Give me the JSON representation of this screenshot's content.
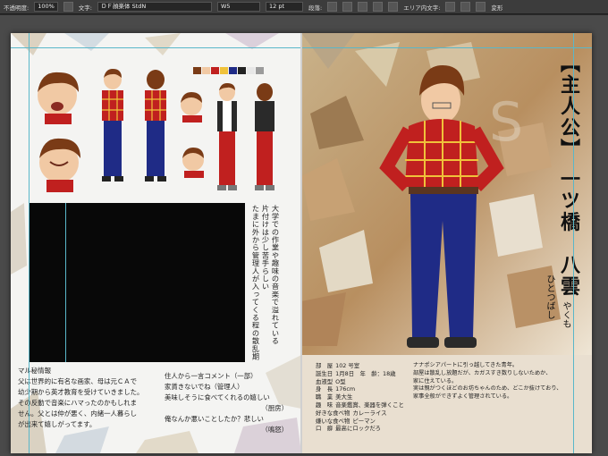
{
  "toolbar": {
    "opacity_label": "不透明度:",
    "opacity_value": "100%",
    "char_label": "文字:",
    "font_name": "ＤＦ顔楽体 StdN",
    "font_weight": "W5",
    "font_size": "12 pt",
    "paragraph_label": "段落:",
    "area_label": "エリア内文字:",
    "transform_label": "変形"
  },
  "left_page": {
    "vertical_text": [
      "大学での作業や趣味の音楽で溢れている",
      "片付けは少し苦手らしい",
      "たまに外から管理人が入ってくる程の散乱期"
    ],
    "intro_heading": "マル秘情報",
    "intro_lines": [
      "父は世界的に有名な画家、母は元ＣＡで",
      "幼少期から英才教育を受けていきました。",
      "その反動で音楽にハマったのかもしれま",
      "せん。父とは仲が悪く、内緒一人暮らし",
      "が出来て嬉しがってます。"
    ],
    "comments_heading": "住人から一言コメント（一部）",
    "comments": [
      {
        "text": "家賃きないでね（管理人）",
        "who": ""
      },
      {
        "text": "美味しそうに食べてくれるの嬉しい",
        "who": ""
      },
      {
        "text": "",
        "who": "（厨房）"
      },
      {
        "text": "俺なんか悪いことしたか？悲しい",
        "who": ""
      },
      {
        "text": "",
        "who": "（鳴怒）"
      }
    ]
  },
  "right_page": {
    "title_bracket": "【主人公】",
    "title_name": "一ツ橋　八雲",
    "reading_family": "ひとつばし",
    "reading_given": "やくも",
    "profile": [
      {
        "k": "部　屋",
        "v": "102 号室"
      },
      {
        "k": "誕生日",
        "v": "1月8日　年　齢：18歳"
      },
      {
        "k": "血液型",
        "v": "O型"
      },
      {
        "k": "身　長",
        "v": "176cm"
      },
      {
        "k": "職　業",
        "v": "美大生"
      },
      {
        "k": "趣　味",
        "v": "音楽鑑賞、楽器を弾くこと"
      },
      {
        "k": "好きな食べ物",
        "v": "カレーライス"
      },
      {
        "k": "嫌いな食べ物",
        "v": "ピーマン"
      },
      {
        "k": "口　癖",
        "v": "最高にロックだろ"
      }
    ],
    "description": [
      "ナナポシアパートに引っ越してきた青年。",
      "部屋は散乱し放題だが、カガスすき数りしないためか、",
      "家に住えている。",
      "実は親がつくほどのお坊ちゃんのため、どこか抜けており、",
      "家事全般ができずよく管理されている。"
    ]
  },
  "colors": {
    "shirt_red": "#c0201f",
    "shirt_check": "#f0c23a",
    "jeans_blue": "#1f2b86",
    "hair_brown": "#7a3b16",
    "accent_cyan": "#59b7c9"
  }
}
